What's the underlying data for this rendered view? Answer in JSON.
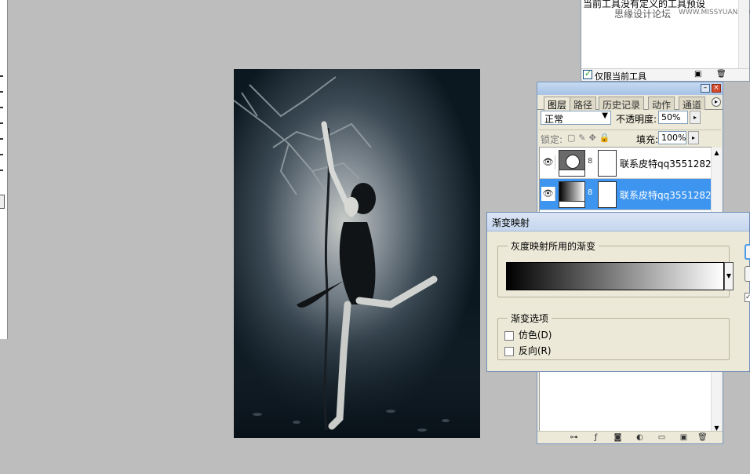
{
  "tool_presets": {
    "message_partial": "当前工具没有定义的工具预设",
    "watermark_cn": "思缘设计论坛",
    "watermark_en": "WWW.MISSYUAN.COM",
    "current_tool_only_label": "仅限当前工具",
    "current_tool_only_checked": true
  },
  "layers_panel": {
    "tabs": [
      {
        "label": "图层",
        "active": true
      },
      {
        "label": "路径",
        "active": false
      },
      {
        "label": "历史记录",
        "active": false
      },
      {
        "label": "动作",
        "active": false
      },
      {
        "label": "通道",
        "active": false
      }
    ],
    "blend_mode": "正常",
    "opacity_label": "不透明度:",
    "opacity_value": "50%",
    "lock_label": "锁定:",
    "fill_label": "填充:",
    "fill_value": "100%",
    "layers": [
      {
        "name": "联系皮特qq3551282",
        "visible": true,
        "selected": false
      },
      {
        "name": "联系皮特qq3551282",
        "visible": true,
        "selected": true
      }
    ]
  },
  "gradient_map_dialog": {
    "title": "渐变映射",
    "group_gradient_label": "灰度映射所用的渐变",
    "group_options_label": "渐变选项",
    "dither_label": "仿色(D)",
    "dither_checked": false,
    "reverse_label": "反向(R)",
    "reverse_checked": false,
    "preview_checked": true,
    "gradient_from": "#000000",
    "gradient_to": "#ffffff"
  },
  "colors": {
    "workspace_bg": "#bdbdbd",
    "selected_row": "#3d95f0",
    "panel_bg": "#ece9d8"
  }
}
